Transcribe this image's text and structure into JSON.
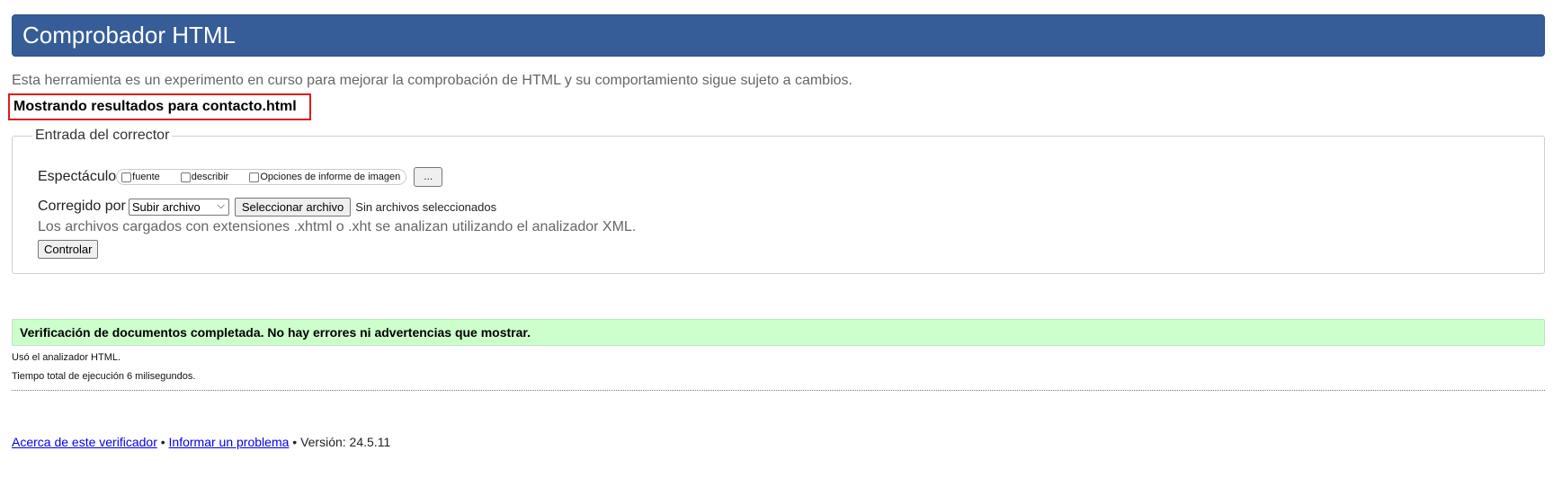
{
  "header": {
    "title": "Comprobador HTML"
  },
  "intro": "Esta herramienta es un experimento en curso para mejorar la comprobación de HTML y su comportamiento sigue sujeto a cambios.",
  "showing_results": "Mostrando resultados para contacto.html",
  "checker": {
    "legend": "Entrada del corrector",
    "show_label": "Espectáculo",
    "options": [
      {
        "label": "fuente",
        "checked": false
      },
      {
        "label": "describir",
        "checked": false
      },
      {
        "label": "Opciones de informe de imagen",
        "checked": false
      }
    ],
    "more_button": "...",
    "checked_by_label": "Corregido por",
    "checked_by_value": "Subir archivo",
    "file_button": "Seleccionar archivo",
    "no_files": "Sin archivos seleccionados",
    "note": "Los archivos cargados con extensiones .xhtml o .xht se analizan utilizando el analizador XML.",
    "submit": "Controlar"
  },
  "result": {
    "success": "Verificación de documentos completada. No hay errores ni advertencias que mostrar.",
    "parser_used": "Usó el analizador HTML.",
    "time": "Tiempo total de ejecución 6 milisegundos."
  },
  "footer": {
    "about_link": "Acerca de este verificador",
    "sep1": "•",
    "report_link": "Informar un problema",
    "sep2": "•",
    "version": "Versión: 24.5.11"
  }
}
